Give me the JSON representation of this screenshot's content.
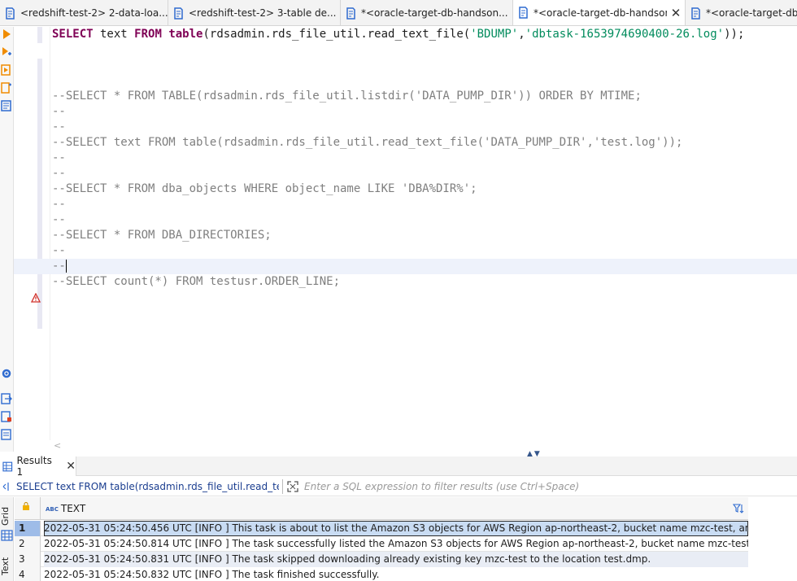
{
  "tabs": [
    {
      "label": "<redshift-test-2> 2-data-loa...",
      "active": false,
      "closable": false
    },
    {
      "label": "<redshift-test-2> 3-table de...",
      "active": false,
      "closable": false
    },
    {
      "label": "*<oracle-target-db-handson...",
      "active": false,
      "closable": false
    },
    {
      "label": "*<oracle-target-db-handson...",
      "active": true,
      "closable": true
    },
    {
      "label": "*<oracle-target-db-h",
      "active": false,
      "closable": false
    }
  ],
  "editor": {
    "line1": {
      "kw1": "SELECT",
      "t1": " text ",
      "kw2": "FROM",
      "t2": " ",
      "kw3": "table",
      "t3": "(rdsadmin.rds_file_util.read_text_file(",
      "s1": "'BDUMP'",
      "t4": ",",
      "s2": "'dbtask-1653974690400-26.log'",
      "t5": "));"
    },
    "comments": [
      "",
      "",
      "",
      "--SELECT * FROM TABLE(rdsadmin.rds_file_util.listdir('DATA_PUMP_DIR')) ORDER BY MTIME;",
      "--",
      "--",
      "--SELECT text FROM table(rdsadmin.rds_file_util.read_text_file('DATA_PUMP_DIR','test.log'));",
      "--",
      "--",
      "--SELECT * FROM dba_objects WHERE object_name LIKE 'DBA%DIR%';",
      "--",
      "--",
      "--SELECT * FROM DBA_DIRECTORIES;",
      "--",
      "--",
      "--SELECT count(*) FROM testusr.ORDER_LINE;"
    ],
    "current_line_index": 14
  },
  "results": {
    "tab_label": "Results 1",
    "query_text": "SELECT text FROM table(rdsadmin.rds_file_util.read_text_f",
    "filter_placeholder": "Enter a SQL expression to filter results (use Ctrl+Space)",
    "side_tabs": {
      "grid": "Grid",
      "text": "Text"
    },
    "column": {
      "type_badge": "ABC",
      "name": "TEXT"
    },
    "rows": [
      {
        "num": "1",
        "text": "2022-05-31 05:24:50.456 UTC [INFO ] This task is about to list the Amazon S3 objects for AWS Region ap-northeast-2, bucket name mzc-test, and prefix ."
      },
      {
        "num": "2",
        "text": "2022-05-31 05:24:50.814 UTC [INFO ] The task successfully listed the Amazon S3 objects for AWS Region ap-northeast-2, bucket name mzc-test, and prefix ."
      },
      {
        "num": "3",
        "text": "2022-05-31 05:24:50.831 UTC [INFO ] The task skipped downloading already existing key mzc-test to the location test.dmp."
      },
      {
        "num": "4",
        "text": "2022-05-31 05:24:50.832 UTC [INFO ] The task finished successfully."
      }
    ]
  },
  "colors": {
    "keyword": "#7f0055",
    "string": "#008b5c",
    "comment": "#7f7f7f",
    "selection": "#c9dcf3",
    "accent_orange": "#f08c00",
    "accent_blue": "#2f6bd0"
  }
}
